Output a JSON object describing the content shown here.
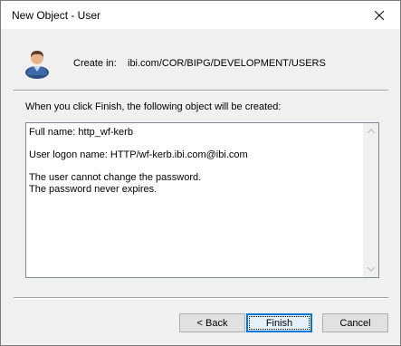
{
  "window": {
    "title": "New Object - User"
  },
  "header": {
    "create_in_label": "Create in:",
    "create_in_path": "ibi.com/COR/BIPG/DEVELOPMENT/USERS",
    "icon": "user-icon"
  },
  "intro_text": "When you click Finish, the following object will be created:",
  "summary": {
    "full_name": "Full name: http_wf-kerb",
    "logon_name": "User logon name: HTTP/wf-kerb.ibi.com@ibi.com",
    "password_change": "The user cannot change the password.",
    "password_expiry": "The password never expires."
  },
  "buttons": {
    "back": "< Back",
    "finish": "Finish",
    "cancel": "Cancel"
  },
  "colors": {
    "dialog_background": "#f0f0f0",
    "focus_accent": "#0078d7"
  }
}
